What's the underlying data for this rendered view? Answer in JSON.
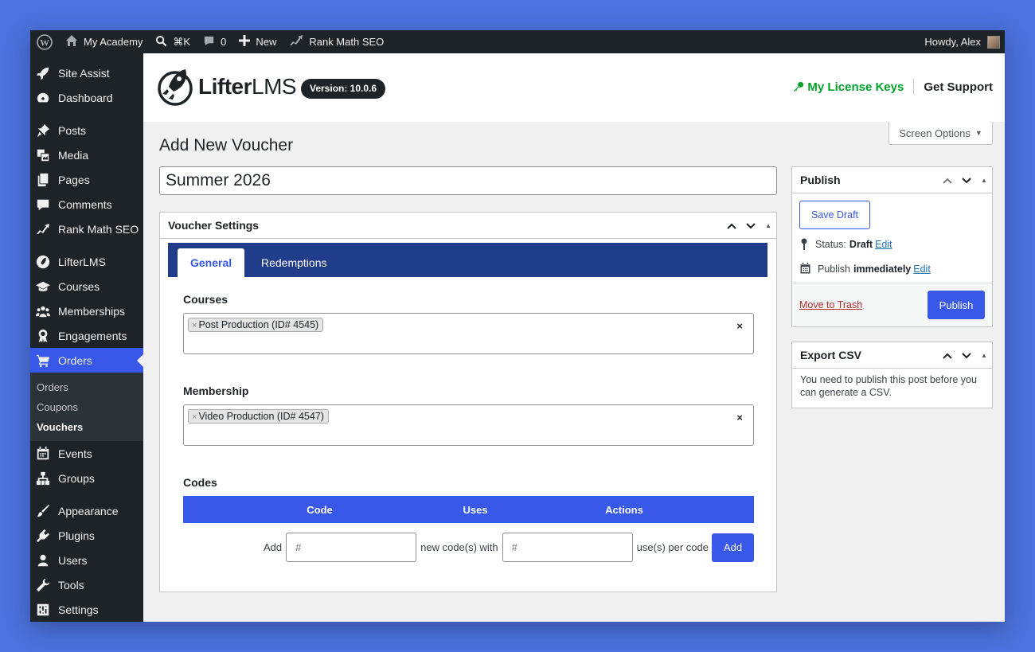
{
  "admin_bar": {
    "site_name": "My Academy",
    "shortcut": "⌘K",
    "comments_count": "0",
    "new_label": "New",
    "seo_label": "Rank Math SEO",
    "greeting": "Howdy, Alex"
  },
  "sidebar": {
    "items": [
      {
        "label": "Site Assist",
        "icon": "rocket-icon"
      },
      {
        "label": "Dashboard",
        "icon": "dashboard-icon"
      },
      {
        "label": "Posts",
        "icon": "pin-icon"
      },
      {
        "label": "Media",
        "icon": "media-icon"
      },
      {
        "label": "Pages",
        "icon": "pages-icon"
      },
      {
        "label": "Comments",
        "icon": "comments-icon"
      },
      {
        "label": "Rank Math SEO",
        "icon": "rankmath-icon"
      },
      {
        "label": "LifterLMS",
        "icon": "lifterlms-icon"
      },
      {
        "label": "Courses",
        "icon": "graduation-cap-icon"
      },
      {
        "label": "Memberships",
        "icon": "groups-icon"
      },
      {
        "label": "Engagements",
        "icon": "award-icon"
      },
      {
        "label": "Orders",
        "icon": "cart-icon"
      },
      {
        "label": "Events",
        "icon": "calendar-icon"
      },
      {
        "label": "Groups",
        "icon": "network-icon"
      },
      {
        "label": "Appearance",
        "icon": "brush-icon"
      },
      {
        "label": "Plugins",
        "icon": "plugin-icon"
      },
      {
        "label": "Users",
        "icon": "user-icon"
      },
      {
        "label": "Tools",
        "icon": "wrench-icon"
      },
      {
        "label": "Settings",
        "icon": "settings-icon"
      }
    ],
    "submenu": [
      "Orders",
      "Coupons",
      "Vouchers"
    ],
    "active_item": "Orders",
    "current_submenu": "Vouchers"
  },
  "header": {
    "logo_text_bold": "Lifter",
    "logo_text_light": "LMS",
    "version": "Version: 10.0.6",
    "license_link": "My License Keys",
    "support_link": "Get Support"
  },
  "screen_options": "Screen Options",
  "page_title": "Add New Voucher",
  "voucher_title": "Summer 2026",
  "voucher_settings": {
    "heading": "Voucher Settings",
    "tabs": [
      "General",
      "Redemptions"
    ],
    "active_tab": "General",
    "courses_label": "Courses",
    "courses_selected": "Post Production (ID# 4545)",
    "membership_label": "Membership",
    "membership_selected": "Video Production (ID# 4547)",
    "codes_label": "Codes",
    "codes_columns": [
      "Code",
      "Uses",
      "Actions"
    ],
    "add_label": "Add",
    "new_codes_text": "new code(s) with",
    "uses_text": "use(s) per code",
    "code_placeholder": "#",
    "uses_placeholder": "#",
    "add_button": "Add"
  },
  "publish": {
    "heading": "Publish",
    "save_draft": "Save Draft",
    "status_label": "Status:",
    "status_value": "Draft",
    "edit": "Edit",
    "publish_label": "Publish",
    "publish_value": "immediately",
    "move_to_trash": "Move to Trash",
    "publish_button": "Publish"
  },
  "export_csv": {
    "heading": "Export CSV",
    "message": "You need to publish this post before you can generate a CSV."
  },
  "colors": {
    "accent": "#3858e9",
    "admin_dark": "#1d2327",
    "tab_bar": "#203c8a",
    "license_green": "#00a32a",
    "background": "#4b72dd"
  }
}
